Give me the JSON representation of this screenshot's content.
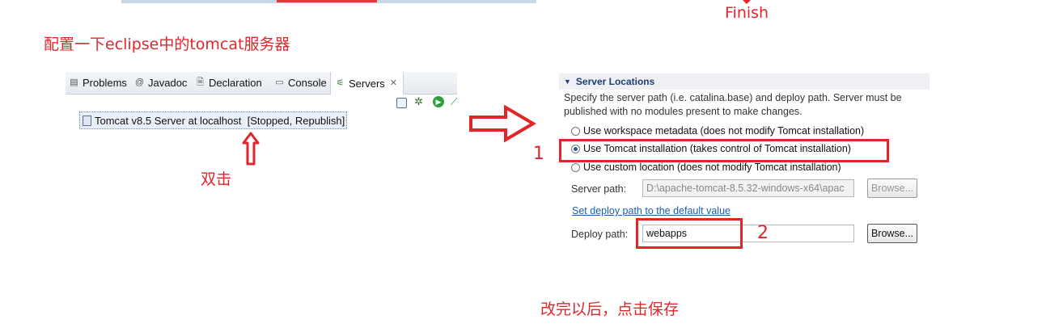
{
  "annotations": {
    "finish": "Finish",
    "configure_note": "配置一下eclipse中的tomcat服务器",
    "double_click": "双击",
    "step1": "1",
    "step2": "2",
    "save_note": "改完以后，点击保存"
  },
  "tabs": [
    {
      "label": "Problems",
      "icon": "problems-icon"
    },
    {
      "label": "Javadoc",
      "icon": "javadoc-icon"
    },
    {
      "label": "Declaration",
      "icon": "declaration-icon"
    },
    {
      "label": "Console",
      "icon": "console-icon"
    },
    {
      "label": "Servers",
      "icon": "servers-icon",
      "active": true
    }
  ],
  "server_entry": {
    "label": "Tomcat v8.5 Server at localhost  [Stopped, Republish]"
  },
  "server_locations": {
    "title": "Server Locations",
    "description": "Specify the server path (i.e. catalina.base) and deploy path. Server must be published with no modules present to make changes.",
    "options": [
      {
        "label": "Use workspace metadata (does not modify Tomcat installation)",
        "selected": false
      },
      {
        "label": "Use Tomcat installation (takes control of Tomcat installation)",
        "selected": true
      },
      {
        "label": "Use custom location (does not modify Tomcat installation)",
        "selected": false
      }
    ],
    "server_path_label": "Server path:",
    "server_path_value": "D:\\apache-tomcat-8.5.32-windows-x64\\apac",
    "browse_label": "Browse...",
    "default_link": "Set deploy path to the default value",
    "deploy_path_label": "Deploy path:",
    "deploy_path_value": "webapps"
  },
  "colors": {
    "annotation_red": "#e0262a",
    "header_blue": "#1d3f73",
    "link_blue": "#1a5ea8"
  }
}
